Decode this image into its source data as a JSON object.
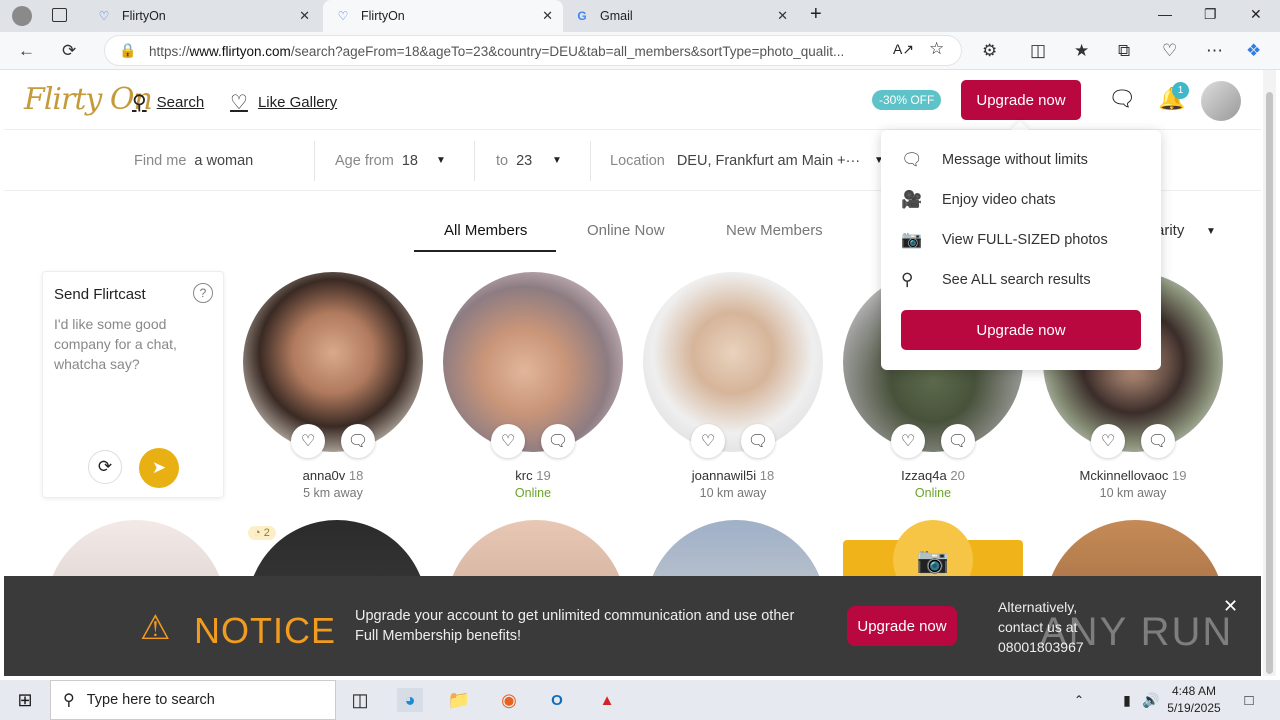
{
  "browser": {
    "tabs": [
      {
        "title": "FlirtyOn",
        "active": false
      },
      {
        "title": "FlirtyOn",
        "active": true
      },
      {
        "title": "Gmail",
        "active": false
      }
    ],
    "url_prefix": "https://",
    "url_host": "www.flirtyon.com",
    "url_rest": "/search?ageFrom=18&ageTo=23&country=DEU&tab=all_members&sortType=photo_qualit..."
  },
  "header": {
    "logo": "Flirty On",
    "search_label": "Search",
    "like_gallery_label": "Like Gallery",
    "discount": "-30% OFF",
    "upgrade_label": "Upgrade now",
    "notif_count": "1"
  },
  "filters": {
    "find_me_label": "Find me",
    "find_me_value": "a woman",
    "age_from_label": "Age from",
    "age_from_value": "18",
    "to_label": "to",
    "to_value": "23",
    "location_label": "Location",
    "location_value": "DEU, Frankfurt am Main +···"
  },
  "tabs": {
    "all": "All Members",
    "online": "Online Now",
    "new": "New Members",
    "sort": "arity"
  },
  "flirtcast": {
    "title": "Send Flirtcast",
    "help": "?",
    "text": "I'd like some good company for a chat, whatcha say?"
  },
  "members": [
    {
      "name": "anna0v",
      "age": "18",
      "status": "5 km away",
      "online": false
    },
    {
      "name": "krc",
      "age": "19",
      "status": "Online",
      "online": true
    },
    {
      "name": "joannawil5i",
      "age": "18",
      "status": "10 km away",
      "online": false
    },
    {
      "name": "Izzaq4a",
      "age": "20",
      "status": "Online",
      "online": true
    },
    {
      "name": "Mckinnellovaoc",
      "age": "19",
      "status": "10 km away",
      "online": false
    }
  ],
  "row2_badge": "2",
  "dropdown": {
    "items": [
      {
        "label": "Message without limits",
        "icon": "chat-bubble-icon"
      },
      {
        "label": "Enjoy video chats",
        "icon": "video-camera-icon"
      },
      {
        "label": "View FULL-SIZED photos",
        "icon": "camera-icon"
      },
      {
        "label": "See ALL search results",
        "icon": "search-icon"
      }
    ],
    "upgrade_label": "Upgrade now"
  },
  "notice": {
    "title": "NOTICE",
    "text": "Upgrade your account to get unlimited communication and use other Full Membership benefits!",
    "upgrade_label": "Upgrade now",
    "alt_line1": "Alternatively,",
    "alt_line2": "contact us at",
    "alt_phone": "08001803967"
  },
  "watermark": "ANY RUN",
  "taskbar": {
    "search_placeholder": "Type here to search",
    "time": "4:48 AM",
    "date": "5/19/2025"
  },
  "colors": {
    "brand_upgrade": "#b9073f",
    "logo_gold": "#c59a3a",
    "online_green": "#6aa22b",
    "notice_orange": "#f29c1f",
    "discount_teal": "#5ec3c8"
  }
}
